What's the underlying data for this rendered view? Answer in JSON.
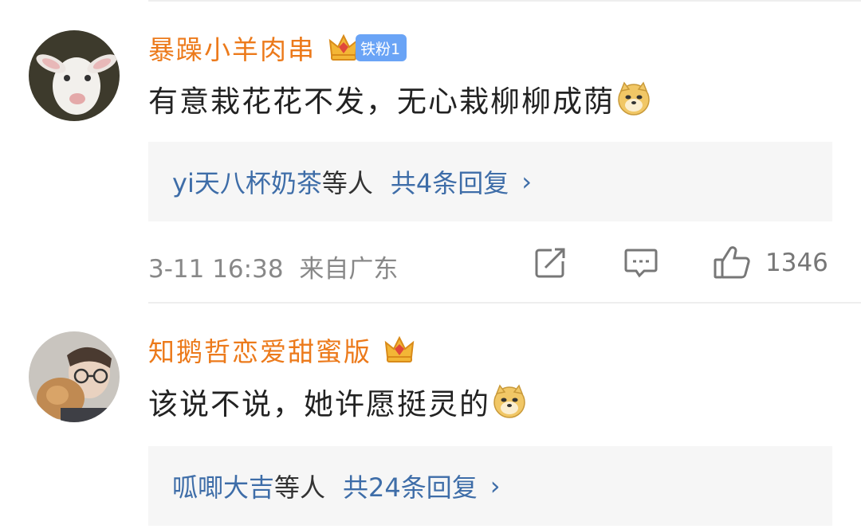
{
  "comments": [
    {
      "username": "暴躁小羊肉串",
      "fan_badge": "铁粉1",
      "content": "有意栽花花不发，无心栽柳柳成荫",
      "content_emoji": "doge-emoji-icon",
      "reply": {
        "users": "yi天八杯奶茶",
        "suffix": "等人",
        "count_text": "共4条回复",
        "chevron": "›"
      },
      "time": "3-11 16:38",
      "location": "来自广东",
      "likes": "1346"
    },
    {
      "username": "知鹅哲恋爱甜蜜版",
      "content": "该说不说，她许愿挺灵的",
      "content_emoji": "doge-emoji-icon",
      "reply": {
        "users": "呱唧大吉",
        "suffix": "等人",
        "count_text": "共24条回复",
        "chevron": "›"
      }
    }
  ],
  "colors": {
    "username": "#ec7a1b",
    "link": "#3e6da8",
    "badge": "#6aa4f6",
    "reply_bg": "#f6f6f6"
  }
}
